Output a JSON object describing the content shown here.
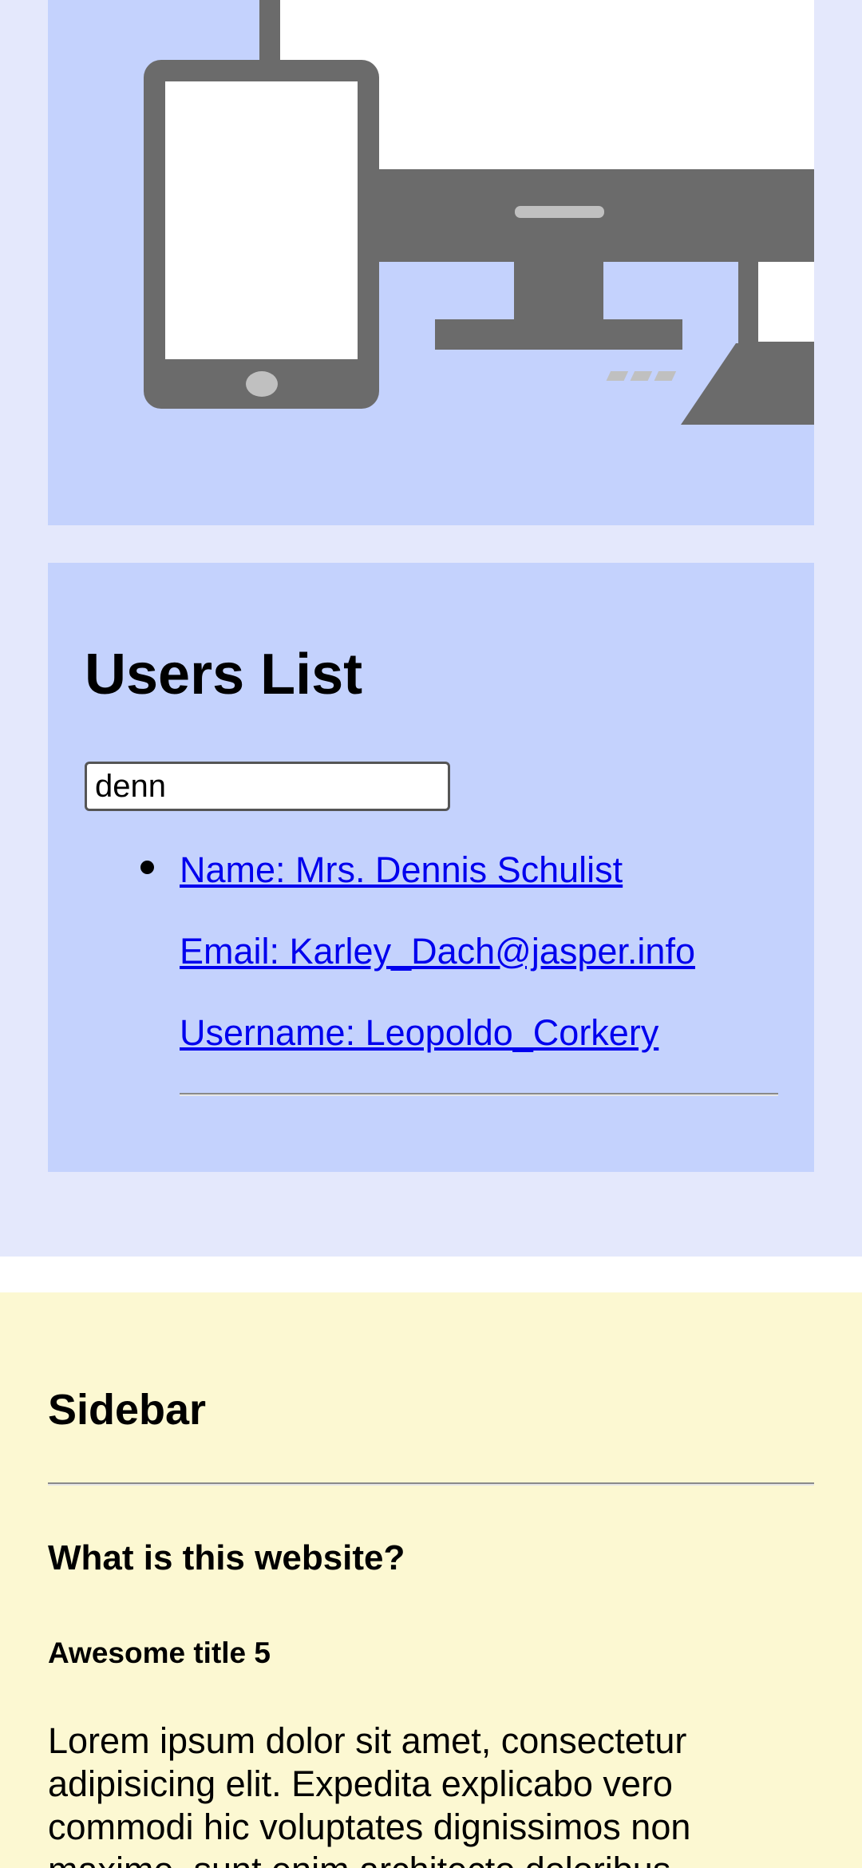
{
  "hero": {
    "icon": "devices-illustration"
  },
  "users": {
    "title": "Users List",
    "search_value": "denn",
    "items": [
      {
        "name": "Name: Mrs. Dennis Schulist",
        "email": "Email: Karley_Dach@jasper.info",
        "username": "Username: Leopoldo_Corkery"
      }
    ]
  },
  "sidebar": {
    "title": "Sidebar",
    "question": "What is this website?",
    "subtitle": "Awesome title 5",
    "text": "Lorem ipsum dolor sit amet, consectetur adipisicing elit. Expedita explicabo vero commodi hic voluptates dignissimos non maxime, sunt enim architecto doloribus"
  },
  "colors": {
    "main_bg": "#e4e8fc",
    "card_bg": "#c4d2fd",
    "sidebar_bg": "#fcf8d2",
    "link": "#0000ee",
    "device_gray": "#6b6b6b"
  }
}
